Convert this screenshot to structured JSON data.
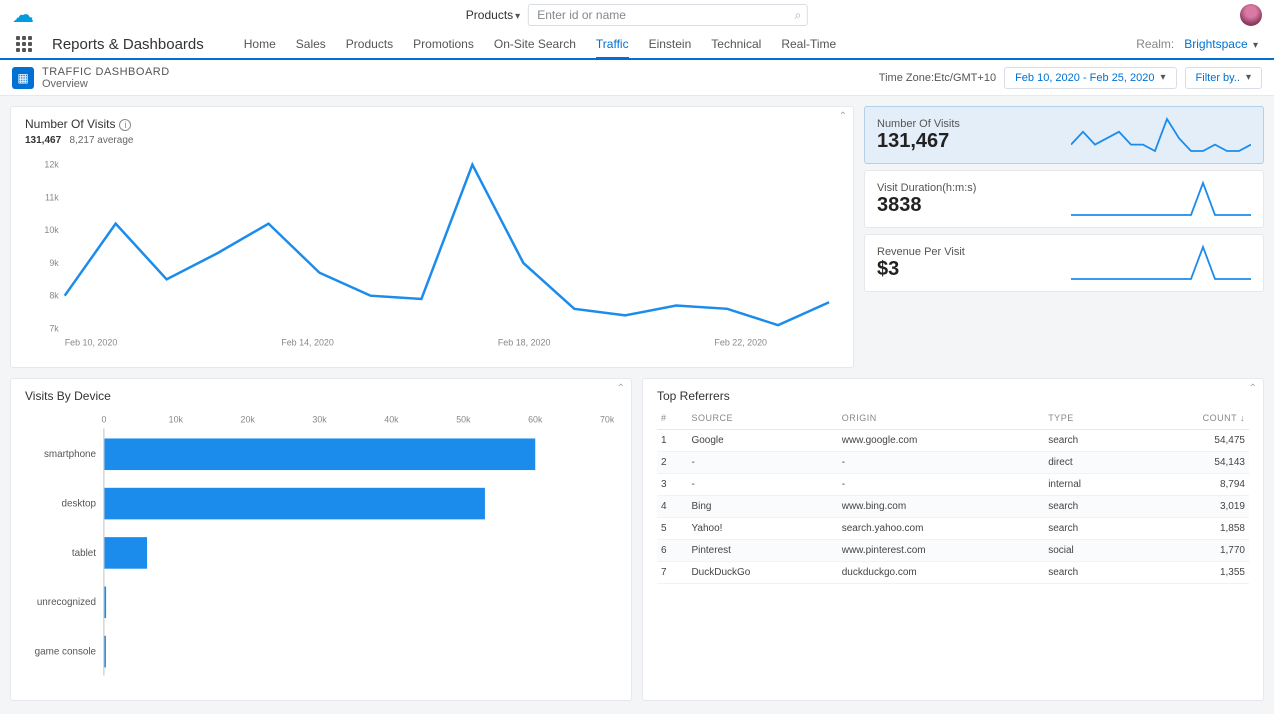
{
  "topbar": {
    "search_category": "Products",
    "search_placeholder": "Enter id or name"
  },
  "nav": {
    "brand": "Reports & Dashboards",
    "items": [
      "Home",
      "Sales",
      "Products",
      "Promotions",
      "On-Site Search",
      "Traffic",
      "Einstein",
      "Technical",
      "Real-Time"
    ],
    "active_index": 5,
    "realm_label": "Realm:",
    "realm_value": "Brightspace"
  },
  "subbar": {
    "title": "TRAFFIC DASHBOARD",
    "subtitle": "Overview",
    "timezone": "Time Zone:Etc/GMT+10",
    "date_range": "Feb 10, 2020 - Feb 25, 2020",
    "filter_label": "Filter by.."
  },
  "visits_panel": {
    "title": "Number Of Visits",
    "total": "131,467",
    "avg_label": "8,217 average"
  },
  "side": [
    {
      "label": "Number Of Visits",
      "value": "131,467"
    },
    {
      "label": "Visit Duration(h:m:s)",
      "value": "3838"
    },
    {
      "label": "Revenue Per Visit",
      "value": "$3"
    }
  ],
  "device_panel": {
    "title": "Visits By Device"
  },
  "referrers_panel": {
    "title": "Top Referrers",
    "headers": {
      "idx": "#",
      "source": "SOURCE",
      "origin": "ORIGIN",
      "type": "TYPE",
      "count": "COUNT"
    },
    "rows": [
      {
        "i": "1",
        "source": "Google",
        "origin": "www.google.com",
        "type": "search",
        "count": "54,475"
      },
      {
        "i": "2",
        "source": "-",
        "origin": "-",
        "type": "direct",
        "count": "54,143"
      },
      {
        "i": "3",
        "source": "-",
        "origin": "-",
        "type": "internal",
        "count": "8,794"
      },
      {
        "i": "4",
        "source": "Bing",
        "origin": "www.bing.com",
        "type": "search",
        "count": "3,019"
      },
      {
        "i": "5",
        "source": "Yahoo!",
        "origin": "search.yahoo.com",
        "type": "search",
        "count": "1,858"
      },
      {
        "i": "6",
        "source": "Pinterest",
        "origin": "www.pinterest.com",
        "type": "social",
        "count": "1,770"
      },
      {
        "i": "7",
        "source": "DuckDuckGo",
        "origin": "duckduckgo.com",
        "type": "search",
        "count": "1,355"
      }
    ]
  },
  "chart_data": [
    {
      "type": "line",
      "title": "Number Of Visits",
      "ylabel": "",
      "xlabel": "",
      "ylim": [
        7000,
        12000
      ],
      "x_ticks": [
        "Feb 10, 2020",
        "Feb 14, 2020",
        "Feb 18, 2020",
        "Feb 22, 2020"
      ],
      "y_ticks": [
        "7k",
        "8k",
        "9k",
        "10k",
        "11k",
        "12k"
      ],
      "x": [
        "Feb 10",
        "Feb 11",
        "Feb 12",
        "Feb 13",
        "Feb 14",
        "Feb 15",
        "Feb 16",
        "Feb 17",
        "Feb 18",
        "Feb 19",
        "Feb 20",
        "Feb 21",
        "Feb 22",
        "Feb 23",
        "Feb 24",
        "Feb 25"
      ],
      "values": [
        8000,
        10200,
        8500,
        9300,
        10200,
        8700,
        8000,
        7900,
        12000,
        9000,
        7600,
        7400,
        7700,
        7600,
        7100,
        7800
      ]
    },
    {
      "type": "bar",
      "orientation": "horizontal",
      "title": "Visits By Device",
      "xlim": [
        0,
        70000
      ],
      "x_ticks": [
        "0",
        "10k",
        "20k",
        "30k",
        "40k",
        "50k",
        "60k",
        "70k"
      ],
      "categories": [
        "smartphone",
        "desktop",
        "tablet",
        "unrecognized",
        "game console"
      ],
      "values": [
        60000,
        53000,
        6000,
        300,
        200
      ]
    }
  ]
}
